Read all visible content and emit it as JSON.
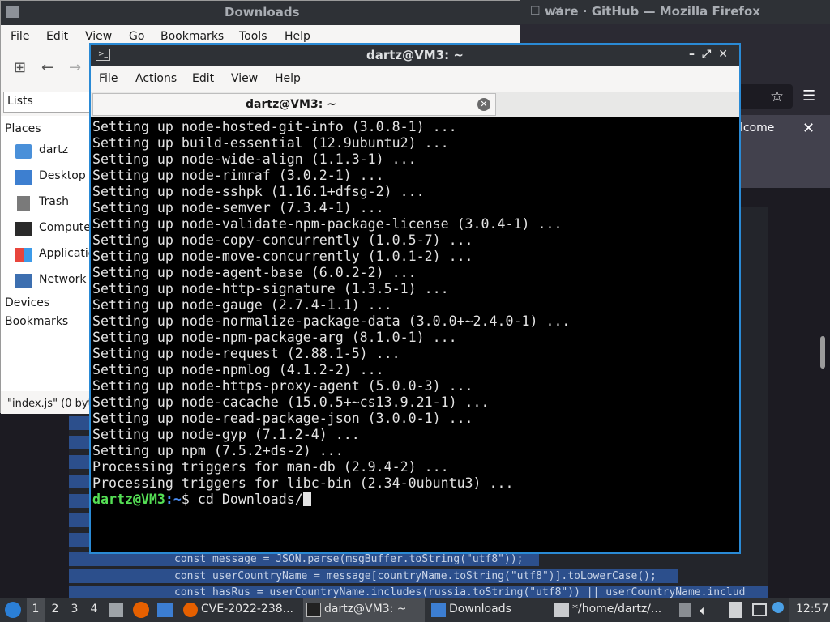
{
  "firefox": {
    "title": "ware · GitHub — Mozilla Firefox",
    "banner_text": "lcome",
    "code_lines": [
      "const message = JSON.parse(msgBuffer.toString(\"utf8\"));",
      "const userCountryName = message[countryName.toString(\"utf8\")].toLowerCase();",
      "const hasRus = userCountryName.includes(russia.toString(\"utf8\")) || userCountryName.includ"
    ]
  },
  "file_manager": {
    "title": "Downloads",
    "menu": [
      "File",
      "Edit",
      "View",
      "Go",
      "Bookmarks",
      "Tools",
      "Help"
    ],
    "lists_label": "Lists",
    "places_label": "Places",
    "places": [
      "dartz",
      "Desktop",
      "Trash",
      "Compute",
      "Applicatio",
      "Network"
    ],
    "devices_label": "Devices",
    "bookmarks_label": "Bookmarks",
    "status": "\"index.js\" (0 byt"
  },
  "terminal": {
    "title": "dartz@VM3: ~",
    "menu": [
      "File",
      "Actions",
      "Edit",
      "View",
      "Help"
    ],
    "tab_title": "dartz@VM3: ~",
    "output_lines": [
      "Setting up node-hosted-git-info (3.0.8-1) ...",
      "Setting up build-essential (12.9ubuntu2) ...",
      "Setting up node-wide-align (1.1.3-1) ...",
      "Setting up node-rimraf (3.0.2-1) ...",
      "Setting up node-sshpk (1.16.1+dfsg-2) ...",
      "Setting up node-semver (7.3.4-1) ...",
      "Setting up node-validate-npm-package-license (3.0.4-1) ...",
      "Setting up node-copy-concurrently (1.0.5-7) ...",
      "Setting up node-move-concurrently (1.0.1-2) ...",
      "Setting up node-agent-base (6.0.2-2) ...",
      "Setting up node-http-signature (1.3.5-1) ...",
      "Setting up node-gauge (2.7.4-1.1) ...",
      "Setting up node-normalize-package-data (3.0.0+~2.4.0-1) ...",
      "Setting up node-npm-package-arg (8.1.0-1) ...",
      "Setting up node-request (2.88.1-5) ...",
      "Setting up node-npmlog (4.1.2-2) ...",
      "Setting up node-https-proxy-agent (5.0.0-3) ...",
      "Setting up node-cacache (15.0.5+~cs13.9.21-1) ...",
      "Setting up node-read-package-json (3.0.0-1) ...",
      "Setting up node-gyp (7.1.2-4) ...",
      "Setting up npm (7.5.2+ds-2) ...",
      "Processing triggers for man-db (2.9.4-2) ...",
      "Processing triggers for libc-bin (2.34-0ubuntu3) ..."
    ],
    "prompt_user": "dartz@VM3",
    "prompt_path": ":~",
    "prompt_symbol": "$ ",
    "command": "cd Downloads/"
  },
  "taskbar": {
    "workspaces": [
      "1",
      "2",
      "3",
      "4"
    ],
    "tasks": [
      {
        "label": "CVE-2022-238..."
      },
      {
        "label": "dartz@VM3: ~"
      },
      {
        "label": "Downloads"
      },
      {
        "label": "*/home/dartz/..."
      }
    ],
    "clock": "12:57"
  }
}
